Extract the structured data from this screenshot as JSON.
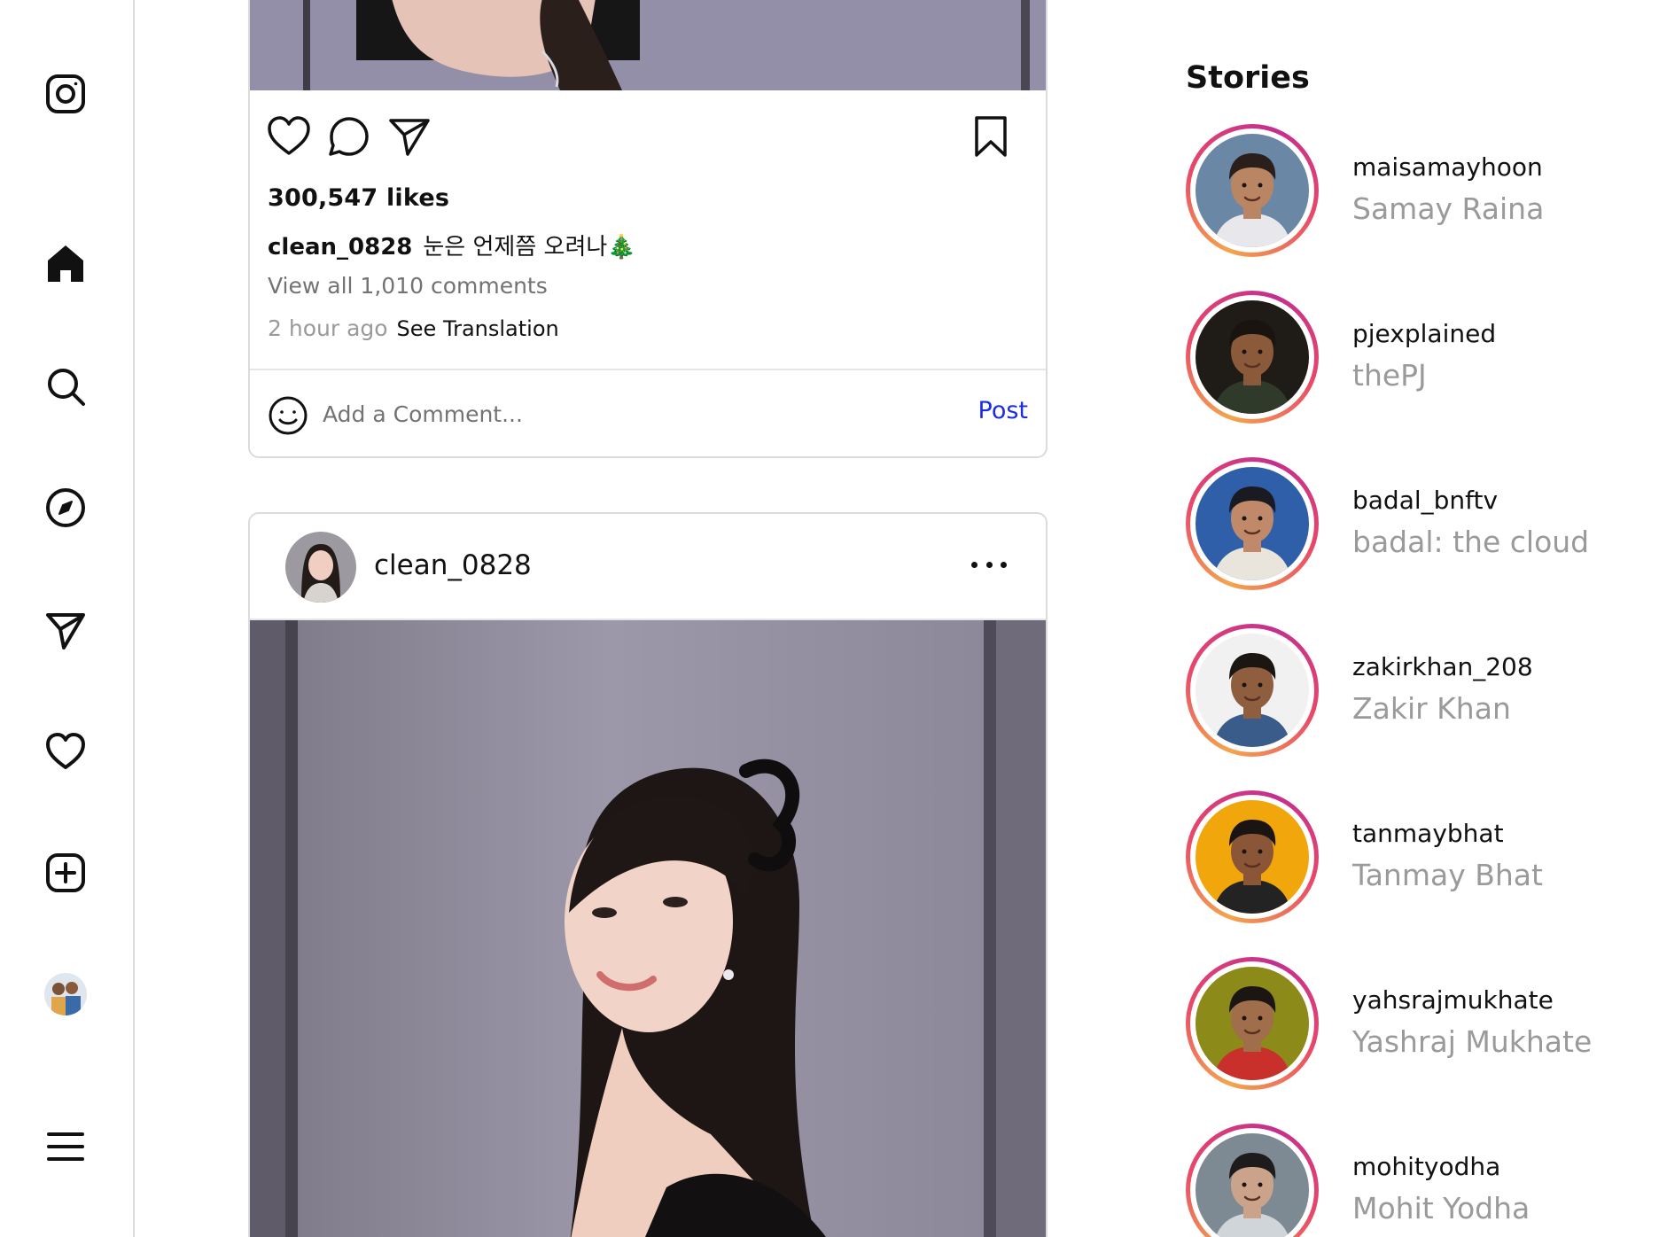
{
  "sidebar": {
    "items": [
      {
        "name": "instagram-logo-icon"
      },
      {
        "name": "home-icon"
      },
      {
        "name": "search-icon"
      },
      {
        "name": "explore-icon"
      },
      {
        "name": "direct-messages-icon"
      },
      {
        "name": "notifications-heart-icon"
      },
      {
        "name": "create-post-icon"
      },
      {
        "name": "profile-avatar"
      },
      {
        "name": "menu-icon"
      }
    ]
  },
  "feed": {
    "post1": {
      "likes": "300,547 likes",
      "caption_user": "clean_0828",
      "caption_text": "눈은 언제쯤 오려나🎄",
      "view_comments": "View all 1,010 comments",
      "time_ago": "2 hour ago",
      "see_translation": "See Translation",
      "comment_placeholder": "Add a Comment...",
      "post_button": "Post"
    },
    "post2": {
      "username": "clean_0828"
    }
  },
  "stories": {
    "title": "Stories",
    "items": [
      {
        "handle": "maisamayhoon",
        "name": "Samay Raina",
        "bg": "#6b87a6",
        "skin": "#b98562",
        "hair": "#2a1f1a",
        "shirt": "#e8e8ec"
      },
      {
        "handle": "pjexplained",
        "name": "thePJ",
        "bg": "#1f1b17",
        "skin": "#8a5a3a",
        "hair": "#1a1410",
        "shirt": "#2f3a2a"
      },
      {
        "handle": "badal_bnftv",
        "name": "badal: the cloud",
        "bg": "#2f5fa8",
        "skin": "#c08a6a",
        "hair": "#1a1a22",
        "shirt": "#e9e4dc"
      },
      {
        "handle": "zakirkhan_208",
        "name": "Zakir Khan",
        "bg": "#f1f1f1",
        "skin": "#8f5e3f",
        "hair": "#1b1612",
        "shirt": "#3a5c8a"
      },
      {
        "handle": "tanmaybhat",
        "name": "Tanmay Bhat",
        "bg": "#f1a60c",
        "skin": "#8a5637",
        "hair": "#1a1412",
        "shirt": "#232323"
      },
      {
        "handle": "yahsrajmukhate",
        "name": "Yashraj Mukhate",
        "bg": "#8c8a18",
        "skin": "#a06e4a",
        "hair": "#1c1612",
        "shirt": "#c9302c"
      },
      {
        "handle": "mohityodha",
        "name": "Mohit Yodha",
        "bg": "#7d8a93",
        "skin": "#caa38a",
        "hair": "#1d1b1b",
        "shirt": "#cfd5d8"
      }
    ]
  },
  "colors": {
    "accent_link": "#1b2be6",
    "border": "#dbdbdb",
    "muted_text": "#737373"
  }
}
